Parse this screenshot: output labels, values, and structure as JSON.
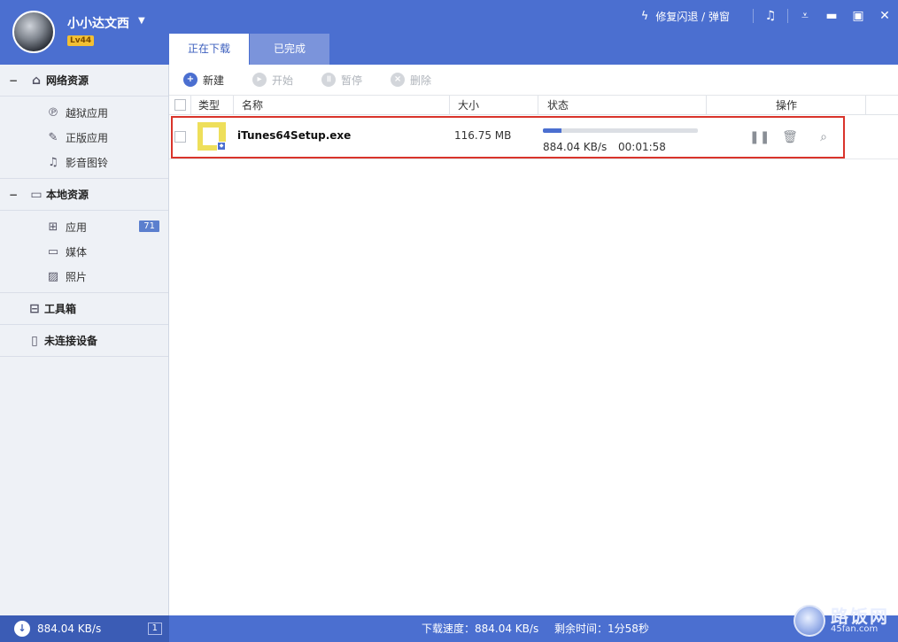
{
  "header": {
    "username": "小小达文西",
    "level": "Lv44",
    "repair_label": "修复闪退 / 弹窗"
  },
  "tabs": [
    {
      "label": "正在下载",
      "active": true
    },
    {
      "label": "已完成",
      "active": false
    }
  ],
  "sidebar": {
    "sections": [
      {
        "label": "网络资源",
        "icon": "home-icon",
        "items": [
          {
            "label": "越狱应用",
            "icon": "jailbreak-app-icon"
          },
          {
            "label": "正版应用",
            "icon": "official-app-icon"
          },
          {
            "label": "影音图铃",
            "icon": "music-note-icon"
          }
        ]
      },
      {
        "label": "本地资源",
        "icon": "monitor-icon",
        "items": [
          {
            "label": "应用",
            "icon": "apps-grid-icon",
            "badge": "71"
          },
          {
            "label": "媒体",
            "icon": "video-camera-icon"
          },
          {
            "label": "照片",
            "icon": "photo-icon"
          }
        ]
      }
    ],
    "toolbox": {
      "label": "工具箱",
      "icon": "toolbox-icon"
    },
    "device": {
      "label": "未连接设备",
      "icon": "device-disconnected-icon"
    }
  },
  "toolbar": {
    "new_label": "新建",
    "start_label": "开始",
    "pause_label": "暂停",
    "delete_label": "删除"
  },
  "table": {
    "headers": {
      "type": "类型",
      "name": "名称",
      "size": "大小",
      "status": "状态",
      "actions": "操作"
    },
    "rows": [
      {
        "name": "iTunes64Setup.exe",
        "size": "116.75 MB",
        "speed": "884.04 KB/s",
        "remaining": "00:01:58",
        "progress": 0.12
      }
    ]
  },
  "statusbar": {
    "left_speed": "884.04 KB/s",
    "count": "1",
    "download_speed": "下载速度：884.04 KB/s",
    "remaining_time": "剩余时间：1分58秒",
    "watermark_text": "路饭网",
    "watermark_url": "45fan.com"
  },
  "colors": {
    "brand": "#4b6fd0",
    "highlight": "#d9342b",
    "level_badge": "#f3c033",
    "file_icon": "#eedf5a"
  }
}
